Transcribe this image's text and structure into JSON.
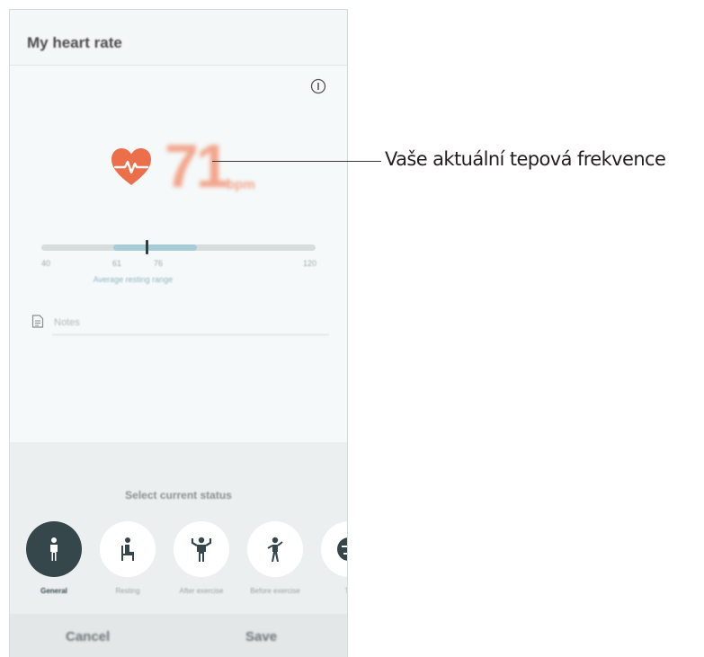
{
  "header": {
    "title": "My heart rate"
  },
  "measurement": {
    "value": "71",
    "unit": "bpm"
  },
  "range": {
    "ticks": [
      "40",
      "61",
      "76",
      "120"
    ],
    "caption": "Average resting range",
    "current_position": 0.37,
    "range_start": 0.26,
    "range_end": 0.57
  },
  "notes": {
    "placeholder": "Notes"
  },
  "status": {
    "title": "Select current status",
    "options": [
      {
        "label": "General",
        "icon": "standing-person-icon",
        "selected": true
      },
      {
        "label": "Resting",
        "icon": "sitting-person-icon",
        "selected": false
      },
      {
        "label": "After exercise",
        "icon": "flexing-person-icon",
        "selected": false
      },
      {
        "label": "Before exercise",
        "icon": "stretching-person-icon",
        "selected": false
      },
      {
        "label": "Tir",
        "icon": "face-icon",
        "selected": false
      }
    ]
  },
  "actions": {
    "cancel": "Cancel",
    "save": "Save"
  },
  "callout": {
    "text": "Vaše aktuální tepová frekvence"
  },
  "colors": {
    "heart": "#ec6f4c",
    "selected_status": "#36474c",
    "range_fill": "#a8ccd6"
  }
}
